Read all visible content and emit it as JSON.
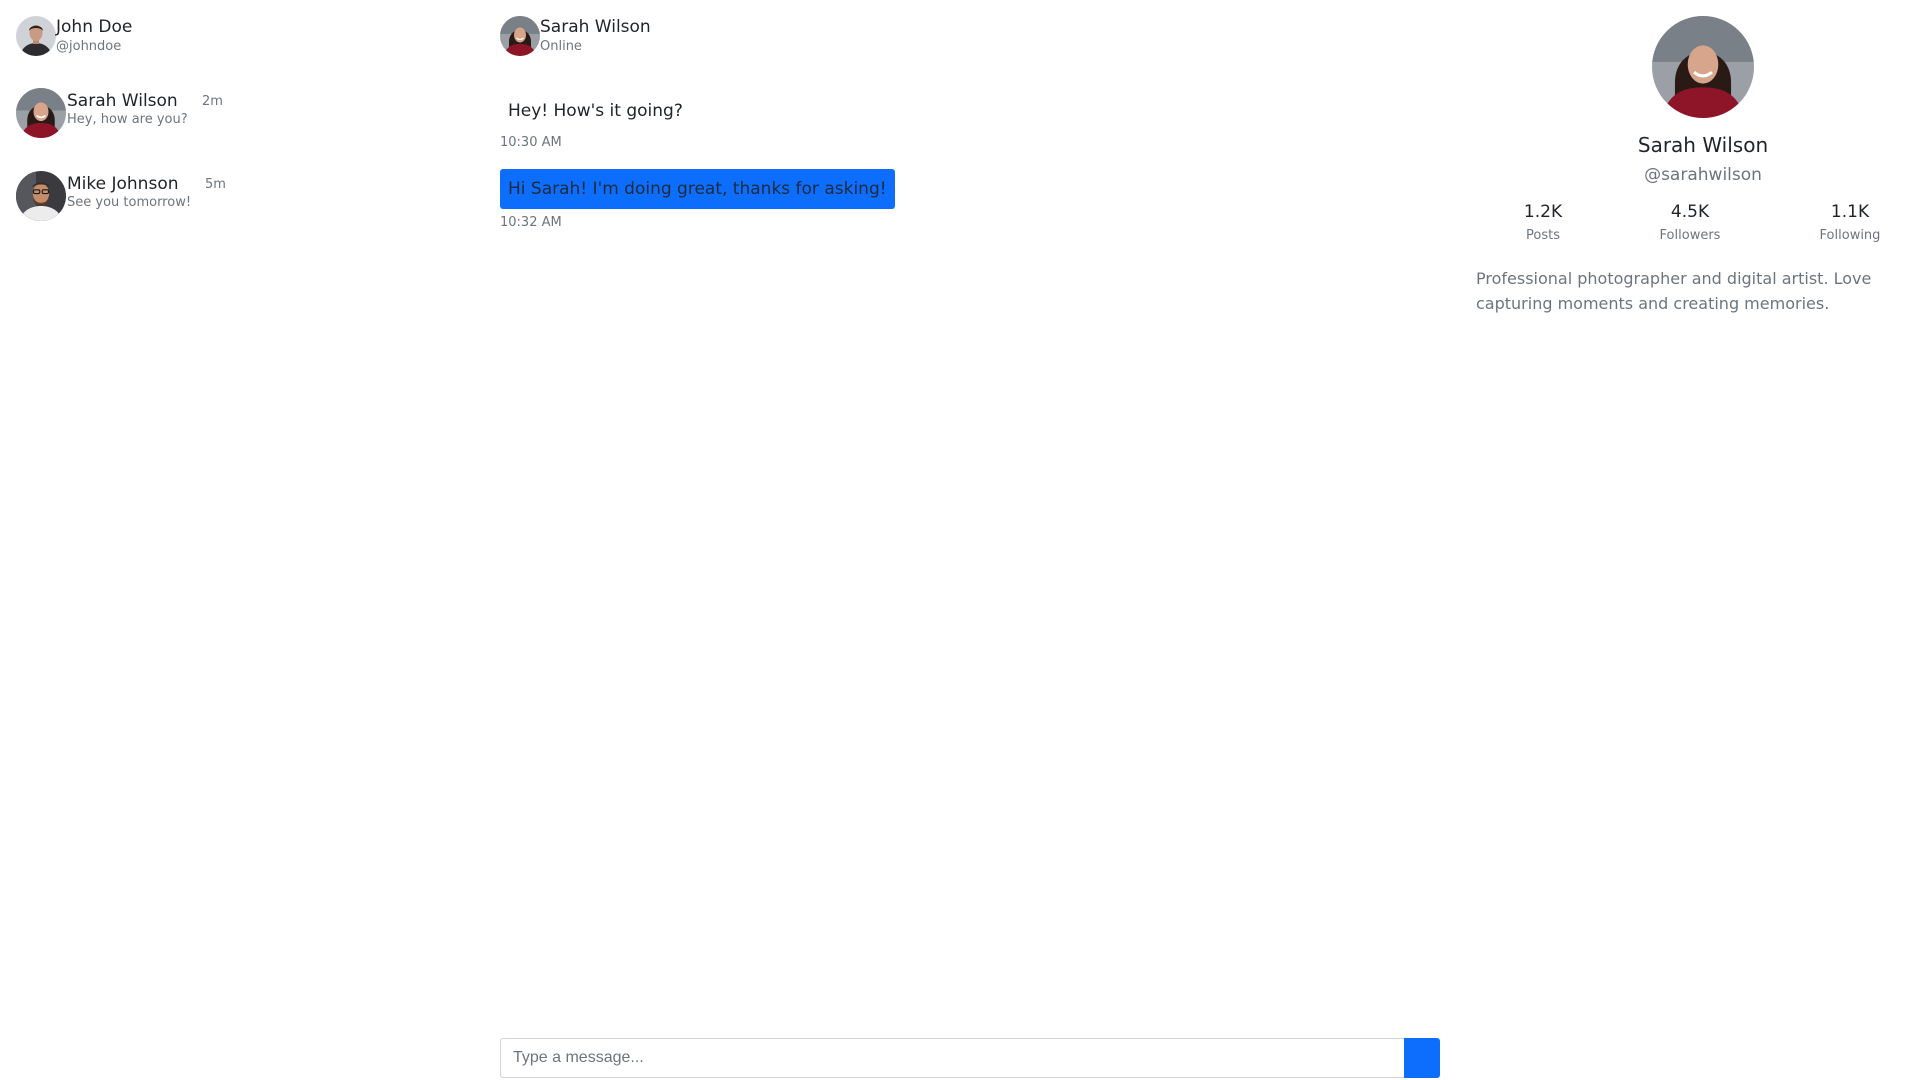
{
  "current_user": {
    "name": "John Doe",
    "handle": "@johndoe"
  },
  "conversations": [
    {
      "name": "Sarah Wilson",
      "time": "2m",
      "preview": "Hey, how are you?"
    },
    {
      "name": "Mike Johnson",
      "time": "5m",
      "preview": "See you tomorrow!"
    }
  ],
  "chat": {
    "contact_name": "Sarah Wilson",
    "status": "Online",
    "messages": [
      {
        "direction": "incoming",
        "text": "Hey! How's it going?",
        "time": "10:30 AM"
      },
      {
        "direction": "outgoing",
        "text": "Hi Sarah! I'm doing great, thanks for asking!",
        "time": "10:32 AM"
      }
    ],
    "input": {
      "value": "",
      "placeholder": "Type a message..."
    },
    "send_icon": "send-icon"
  },
  "profile": {
    "name": "Sarah Wilson",
    "handle": "@sarahwilson",
    "stats": [
      {
        "value": "1.2K",
        "label": "Posts"
      },
      {
        "value": "4.5K",
        "label": "Followers"
      },
      {
        "value": "1.1K",
        "label": "Following"
      }
    ],
    "bio": "Professional photographer and digital artist. Love capturing moments and creating memories."
  },
  "colors": {
    "accent": "#0d6efd",
    "muted_text": "#6c757d",
    "text": "#212529"
  }
}
